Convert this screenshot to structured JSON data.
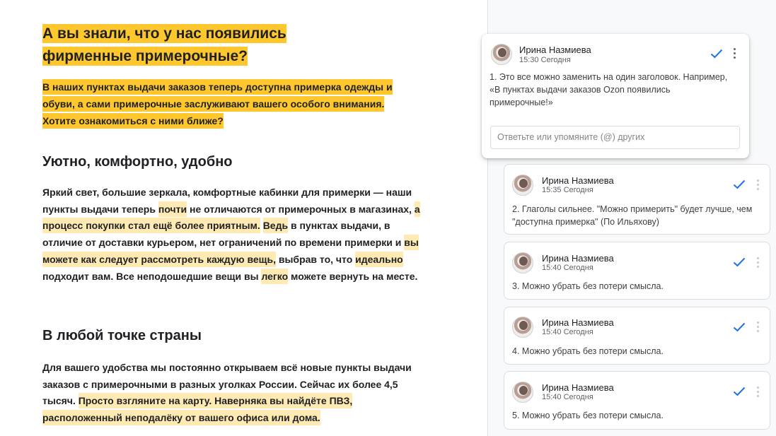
{
  "document": {
    "title": "А вы знали, что у нас появились фирменные примерочные?",
    "lead": "В наших пунктах выдачи заказов теперь доступна примерка одежды и обуви, а сами примерочные заслуживают вашего особого внимания. Хотите ознакомиться с ними ближе?",
    "section1": {
      "heading": "Уютно, комфортно, удобно",
      "p_a": "Яркий свет, большие зеркала, комфортные кабинки для примерки — наши пункты выдачи теперь ",
      "p_b": "почти",
      "p_c": " не отличаются от примерочных в магазинах, ",
      "p_d": "а процесс покупки стал ещё более приятным.",
      "p_e": " ",
      "p_f": "Ведь",
      "p_g": " в пунктах выдачи, в отличие от доставки курьером, нет ограничений по времени примерки и ",
      "p_h": "вы можете как следует рассмотреть каждую вещь,",
      "p_i": " выбрав то, что ",
      "p_j": "идеально",
      "p_k": " подходит вам. Все неподошедшие вещи вы ",
      "p_l": "легко",
      "p_m": " можете вернуть на месте."
    },
    "section2": {
      "heading": "В любой точке страны",
      "p_a": "Для вашего удобства мы постоянно открываем всё новые пункты выдачи заказов с примерочными в разных уголках России. Сейчас их более 4,5 тысяч. ",
      "p_b": "Просто взгляните на карту. Наверняка вы найдёте ПВЗ, расположенный неподалёку от вашего офиса или дома."
    }
  },
  "comments": [
    {
      "author": "Ирина Назмиева",
      "time": "15:30 Сегодня",
      "text": "1. Это все можно заменить на один заголовок. Например, «В пунктах выдачи заказов Ozon появились примерочные!»",
      "active": true
    },
    {
      "author": "Ирина Назмиева",
      "time": "15:35 Сегодня",
      "text": "2. Глаголы сильнее.  \"Можно примерить\" будет лучше, чем \"доступна примерка\" (По Ильяхову)"
    },
    {
      "author": "Ирина Назмиева",
      "time": "15:40 Сегодня",
      "text": "3. Можно убрать без потери смысла."
    },
    {
      "author": "Ирина Назмиева",
      "time": "15:40 Сегодня",
      "text": "4. Можно убрать без потери смысла."
    },
    {
      "author": "Ирина Назмиева",
      "time": "15:40 Сегодня",
      "text": "5. Можно убрать без потери смысла."
    }
  ],
  "reply": {
    "placeholder": "Ответьте или упомяните (@) других"
  },
  "colors": {
    "highlight_strong": "#ffc72e",
    "highlight_soft": "#feeab2",
    "check": "#1a73e8"
  },
  "icons": {
    "resolve": "check-icon",
    "more": "more-vert-icon"
  }
}
